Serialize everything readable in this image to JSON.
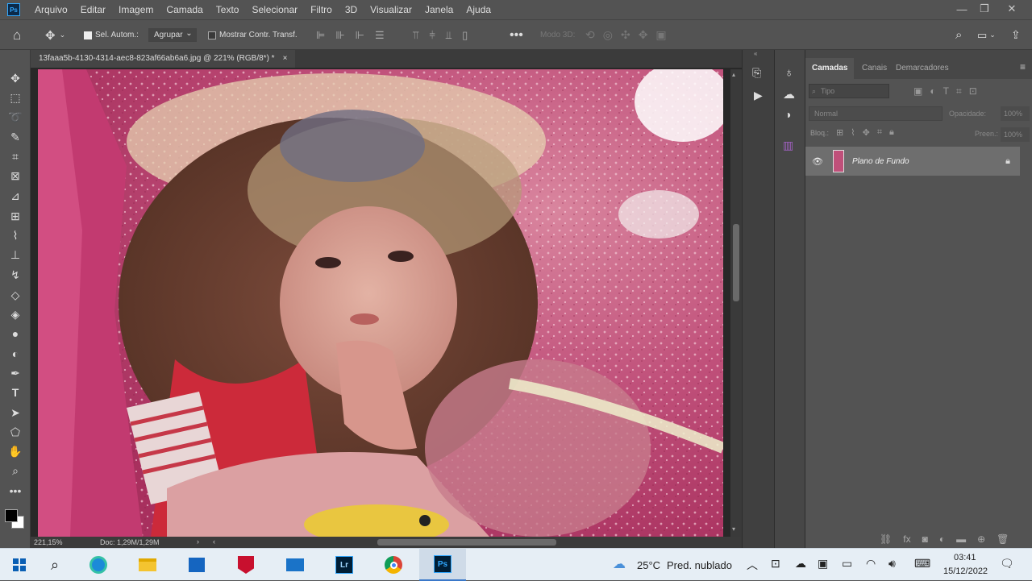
{
  "app": {
    "logo": "Ps",
    "menu": [
      "Arquivo",
      "Editar",
      "Imagem",
      "Camada",
      "Texto",
      "Selecionar",
      "Filtro",
      "3D",
      "Visualizar",
      "Janela",
      "Ajuda"
    ]
  },
  "options": {
    "auto_select_label": "Sel. Autom.:",
    "group_value": "Agrupar",
    "transform_label": "Mostrar Contr. Transf.",
    "mode3d_label": "Modo 3D:"
  },
  "document": {
    "tab_title": "13faaa5b-4130-4314-aec8-823af66ab6a6.jpg @ 221% (RGB/8*) *",
    "close_glyph": "×",
    "zoom": "221,15%",
    "doc_info": "Doc: 1,29M/1,29M"
  },
  "layers_panel": {
    "tabs": [
      "Camadas",
      "Canais",
      "Demarcadores"
    ],
    "search_placeholder": "Tipo",
    "blend_mode": "Normal",
    "opacity_label": "Opacidade:",
    "opacity_value": "100%",
    "lock_label": "Bloq.:",
    "fill_label": "Preen.:",
    "fill_value": "100%",
    "layer_name": "Plano de Fundo"
  },
  "taskbar": {
    "weather_temp": "25°C",
    "weather_desc": "Pred. nublado",
    "time": "03:41",
    "date": "15/12/2022",
    "lr_label": "Lr",
    "ps_label": "Ps"
  },
  "colors": {
    "ps_accent": "#31a8ff",
    "panel_bg": "#535353",
    "canvas_pink": "#c0507a"
  }
}
